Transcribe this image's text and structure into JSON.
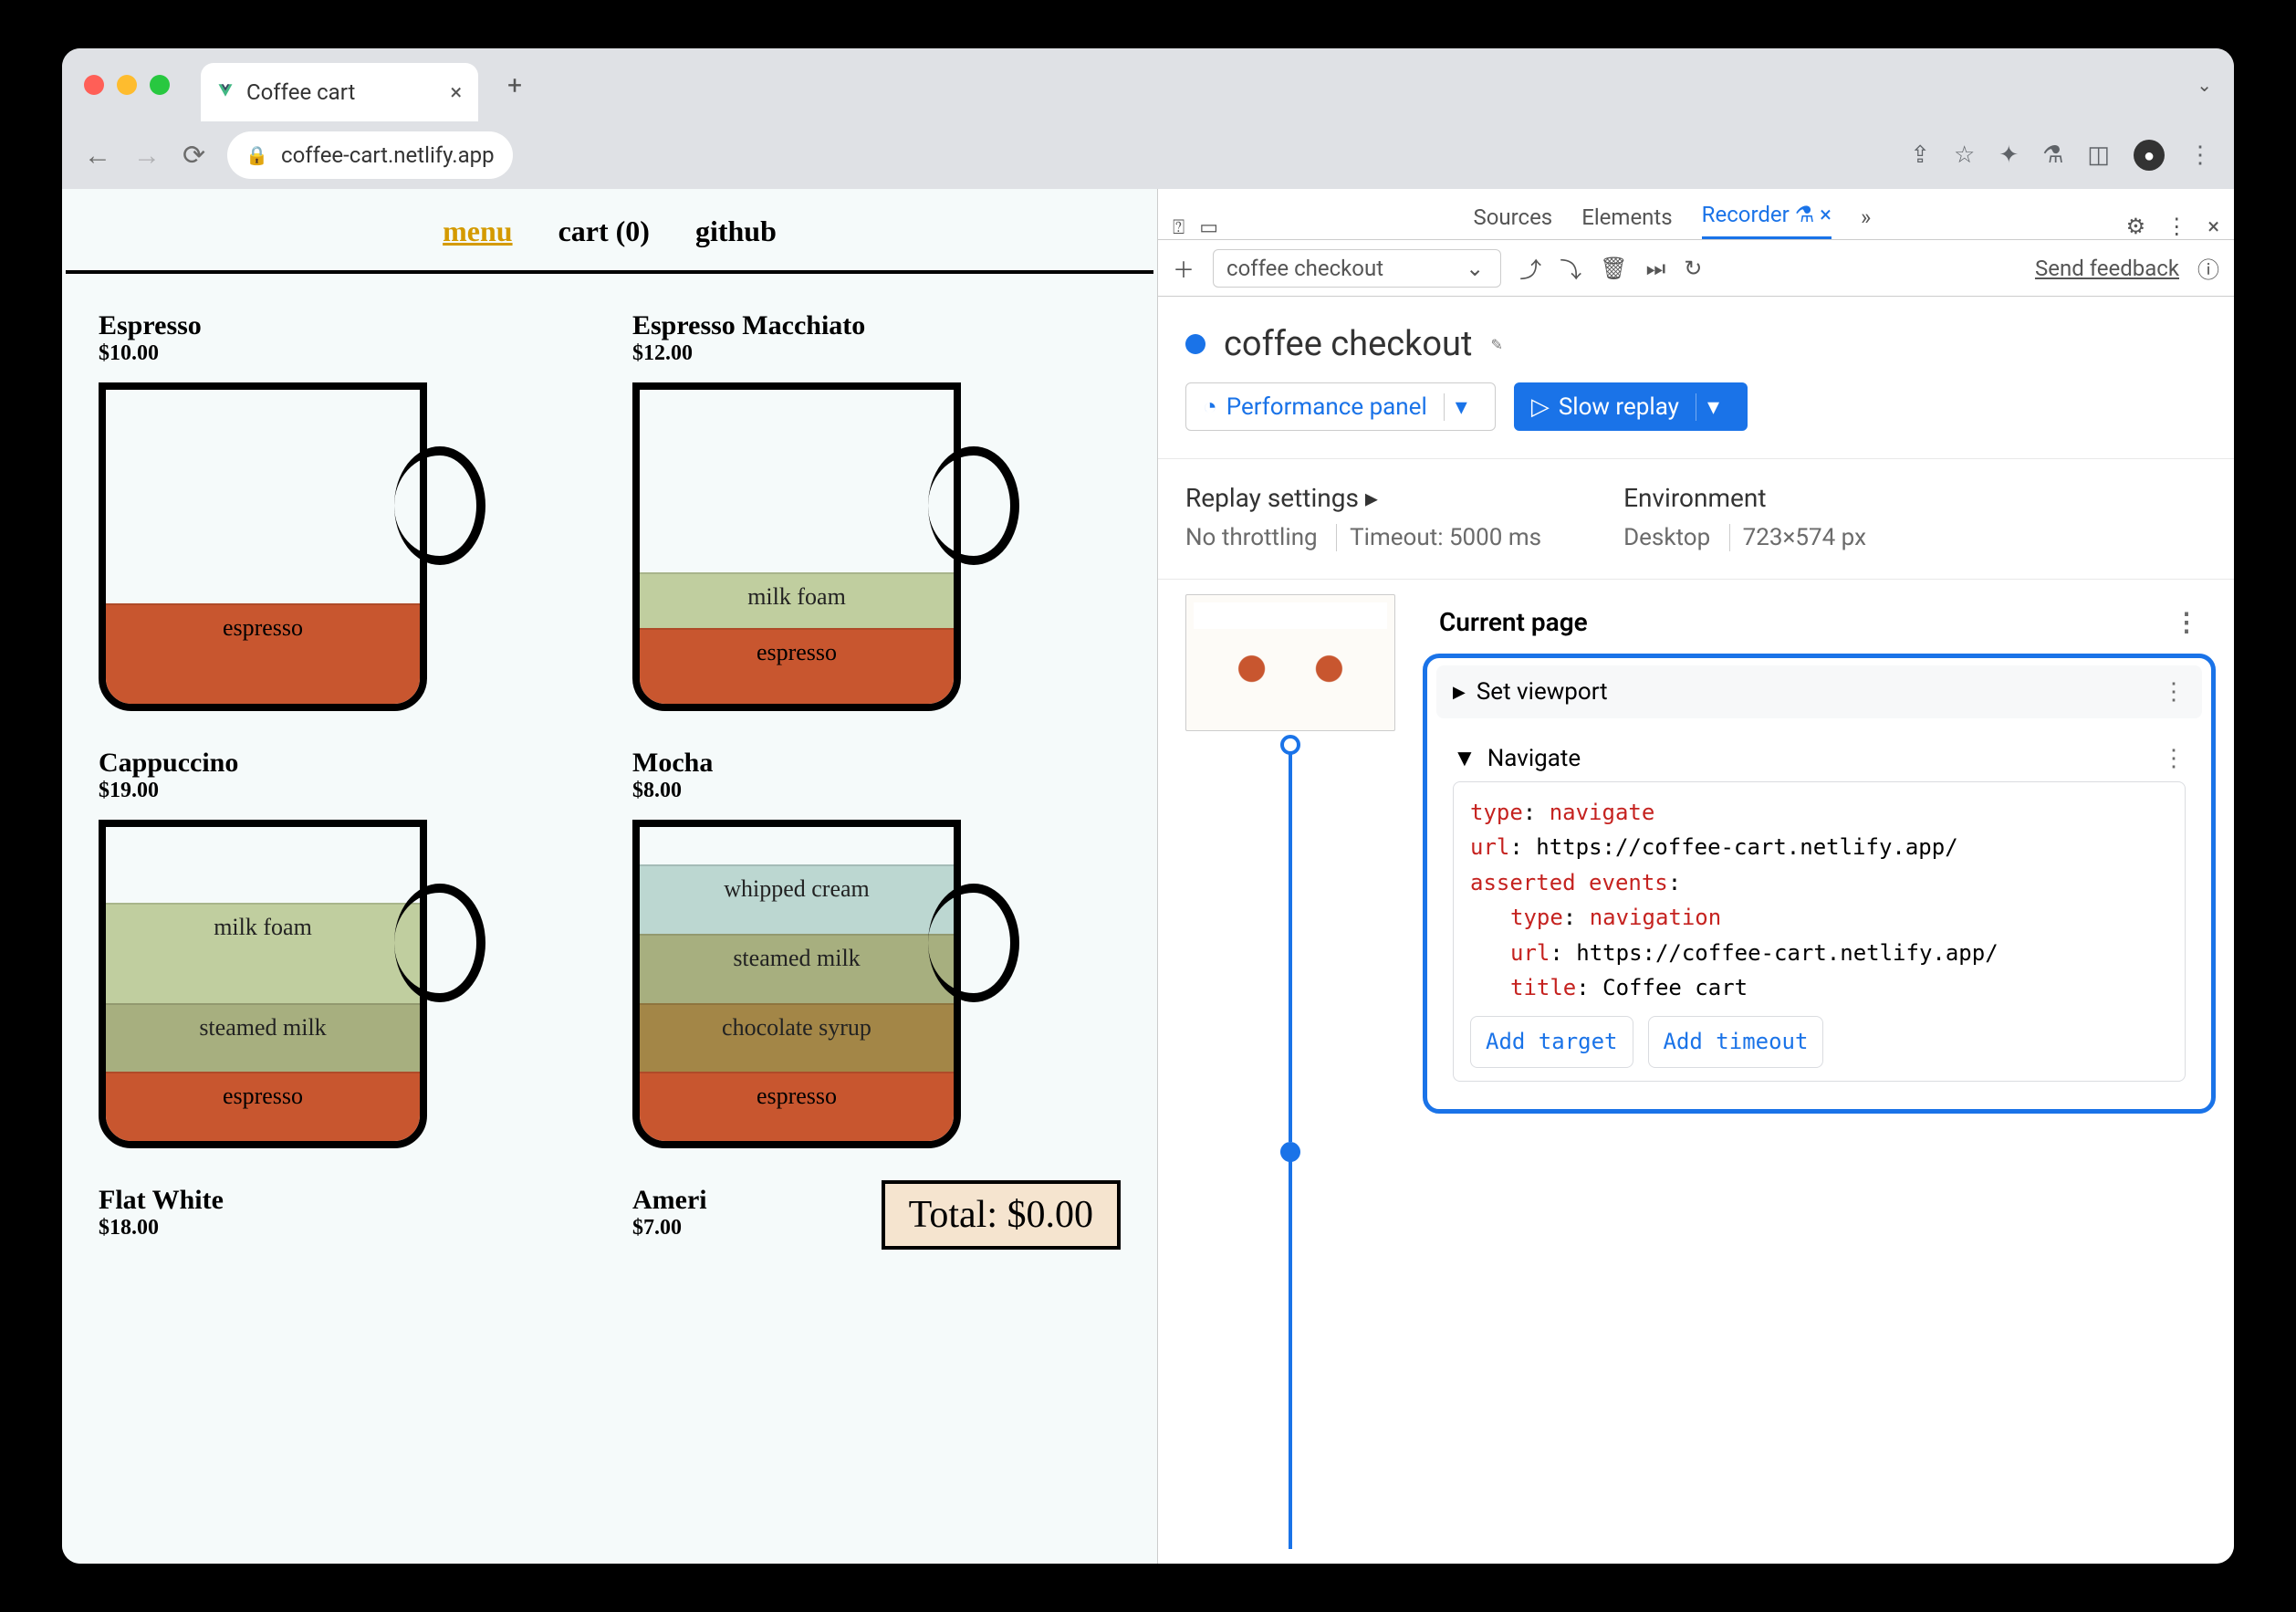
{
  "browser": {
    "tab_title": "Coffee cart",
    "url": "coffee-cart.netlify.app",
    "new_tab": "+",
    "close": "×"
  },
  "page_nav": {
    "menu": "menu",
    "cart": "cart (0)",
    "github": "github"
  },
  "products": [
    {
      "name": "Espresso",
      "price": "$10.00"
    },
    {
      "name": "Espresso Macchiato",
      "price": "$12.00"
    },
    {
      "name": "Cappuccino",
      "price": "$19.00"
    },
    {
      "name": "Mocha",
      "price": "$8.00"
    },
    {
      "name": "Flat White",
      "price": "$18.00"
    },
    {
      "name": "Ameri",
      "price": "$7.00"
    }
  ],
  "layers": {
    "espresso": "espresso",
    "milk_foam": "milk foam",
    "steamed_milk": "steamed milk",
    "whipped_cream": "whipped cream",
    "chocolate_syrup": "chocolate syrup"
  },
  "total": "Total: $0.00",
  "devtools": {
    "tabs": {
      "sources": "Sources",
      "elements": "Elements",
      "recorder": "Recorder",
      "more": "»"
    },
    "toolbar": {
      "recording": "coffee checkout",
      "feedback": "Send feedback",
      "plus": "＋"
    },
    "recording_title": "coffee checkout",
    "perf_btn": "Performance panel",
    "replay_btn": "Slow replay",
    "replay_settings": {
      "title": "Replay settings",
      "throttle": "No throttling",
      "timeout": "Timeout: 5000 ms"
    },
    "environment": {
      "title": "Environment",
      "device": "Desktop",
      "viewport": "723×574 px"
    },
    "steps": {
      "current_page": "Current page",
      "set_viewport": "Set viewport",
      "navigate": "Navigate",
      "code": {
        "type_label": "type",
        "type_val": "navigate",
        "url_label": "url",
        "url_val": "https://coffee-cart.netlify.app/",
        "asserted": "asserted events",
        "nav_type": "navigation",
        "nav_url": "https://coffee-cart.netlify.app/",
        "title_label": "title",
        "title_val": "Coffee cart"
      },
      "add_target": "Add target",
      "add_timeout": "Add timeout"
    }
  }
}
